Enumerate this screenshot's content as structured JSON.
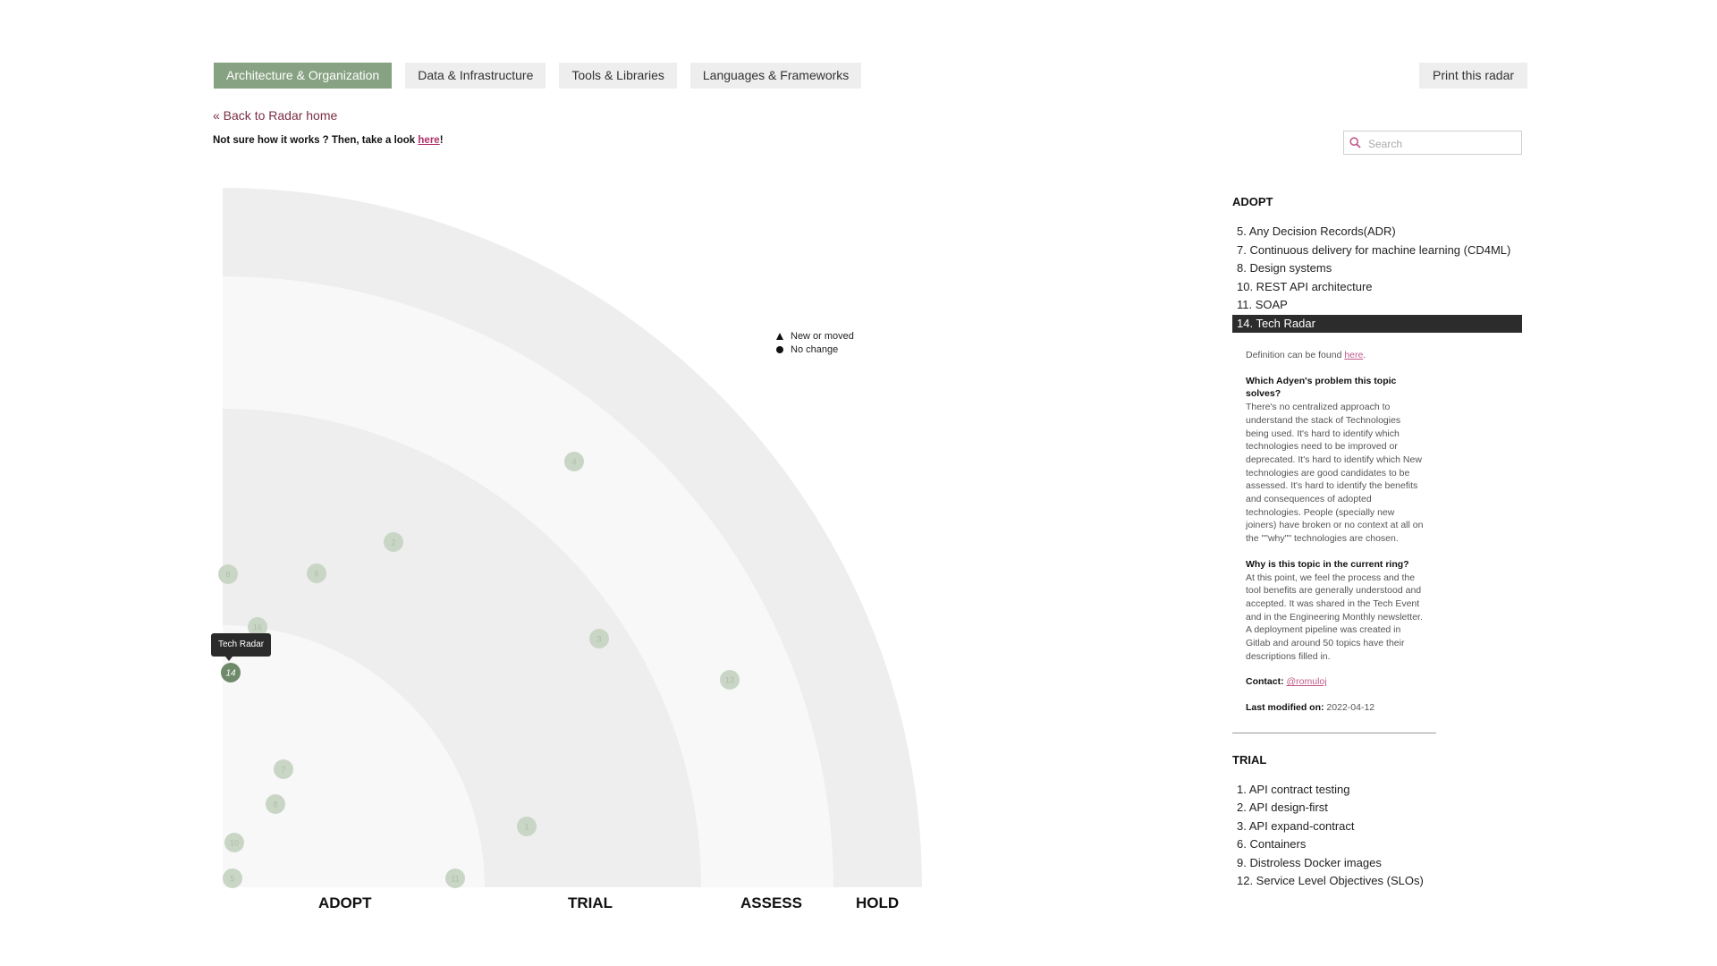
{
  "tabs": [
    {
      "label": "Architecture & Organization",
      "active": true
    },
    {
      "label": "Data & Infrastructure",
      "active": false
    },
    {
      "label": "Tools & Libraries",
      "active": false
    },
    {
      "label": "Languages & Frameworks",
      "active": false
    }
  ],
  "print_label": "Print this radar",
  "back_link": "« Back to Radar home",
  "hint": {
    "text": "Not sure how it works ? Then, take a look ",
    "link": "here",
    "suffix": "!"
  },
  "search": {
    "placeholder": "Search"
  },
  "legend": {
    "new_or_moved": "New or moved",
    "no_change": "No change"
  },
  "rings": [
    "ADOPT",
    "TRIAL",
    "ASSESS",
    "HOLD"
  ],
  "tooltip": "Tech Radar",
  "blips": [
    {
      "label": "4"
    },
    {
      "label": "2"
    },
    {
      "label": "8"
    },
    {
      "label": "6"
    },
    {
      "label": "16"
    },
    {
      "label": "14"
    },
    {
      "label": "3"
    },
    {
      "label": "13"
    },
    {
      "label": "7"
    },
    {
      "label": "8"
    },
    {
      "label": "10"
    },
    {
      "label": "5"
    },
    {
      "label": "11"
    },
    {
      "label": "1"
    }
  ],
  "sidebar": {
    "adopt_title": "ADOPT",
    "adopt_items": [
      "5. Any Decision Records(ADR)",
      "7. Continuous delivery for machine learning (CD4ML)",
      "8. Design systems",
      "10. REST API architecture",
      "11. SOAP",
      "14. Tech Radar"
    ],
    "detail": {
      "definition": "Definition can be found ",
      "definition_link": "here",
      "definition_suffix": ".",
      "problem_q": "Which Adyen's problem this topic solves?",
      "problem_a": "There's no centralized approach to understand the stack of Technologies being used. It's hard to identify which technologies need to be improved or deprecated. It's hard to identify which New technologies are good candidates to be assessed. It's hard to identify the benefits and consequences of adopted technologies. People (specially new joiners) have broken or no context at all on the \"\"why\"\" technologies are chosen.",
      "ring_q": "Why is this topic in the current ring?",
      "ring_a": "At this point, we feel the process and the tool benefits are generally understood and accepted. It was shared in the Tech Event and in the Engineering Monthly newsletter. A deployment pipeline was created in Gitlab and around 50 topics have their descriptions filled in.",
      "contact_label": "Contact:",
      "contact_value": "@romuloj",
      "modified_label": "Last modified on:",
      "modified_value": "2022-04-12"
    },
    "trial_title": "TRIAL",
    "trial_items": [
      "1. API contract testing",
      "2. API design-first",
      "3. API expand-contract",
      "6. Containers",
      "9. Distroless Docker images",
      "12. Service Level Objectives (SLOs)"
    ]
  },
  "colors": {
    "accent": "#87a282",
    "blip": "#c9d6c6",
    "blip_active": "#6e8a6a",
    "ring_dark": "#eeeeee",
    "ring_light": "#f8f8f8"
  }
}
